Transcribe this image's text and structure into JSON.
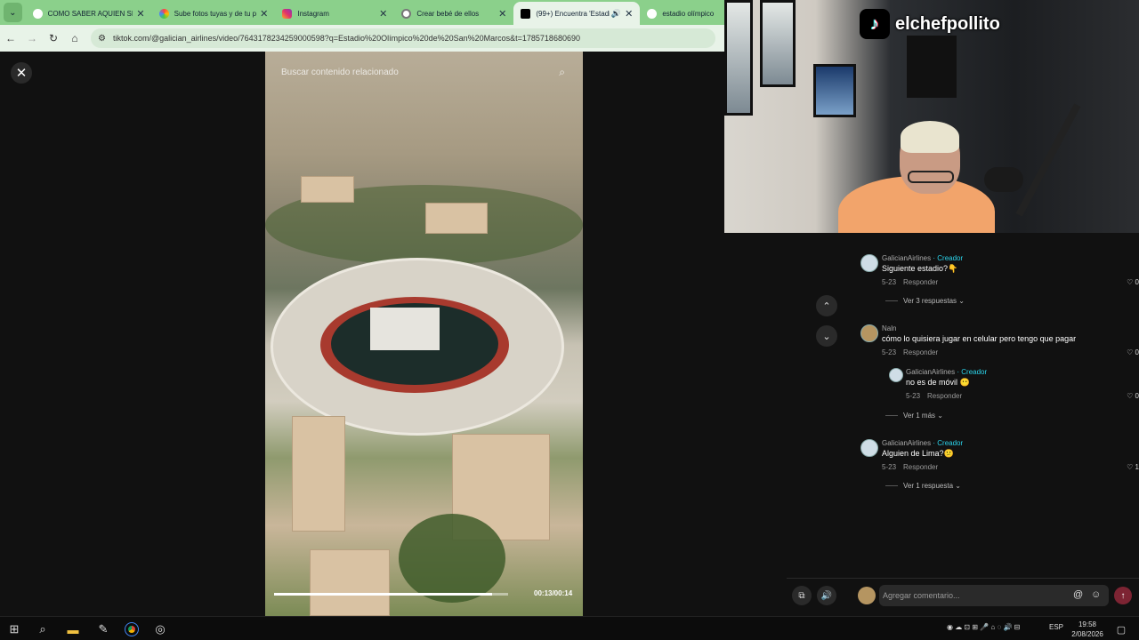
{
  "browser": {
    "tabs": [
      {
        "title": "COMO SABER AQUIEN SE",
        "favicon_color": "#ffffff",
        "active": false
      },
      {
        "title": "Sube fotos tuyas y de tu p",
        "favicon_color": "#ffb300",
        "active": false
      },
      {
        "title": "Instagram",
        "favicon_color": "#e1306c",
        "active": false
      },
      {
        "title": "Crear bebé de ellos",
        "favicon_color": "#ffffff",
        "active": false
      },
      {
        "title": "(99+) Encuentra 'Estadi",
        "favicon_color": "#000000",
        "active": true
      },
      {
        "title": "estadio olímpico",
        "favicon_color": "#ffffff",
        "active": false
      }
    ],
    "url": "tiktok.com/@galician_airlines/video/7643178234259000598?q=Estadio%20Olímpico%20de%20San%20Marcos&t=1785718680690"
  },
  "video": {
    "search_placeholder": "Buscar contenido relacionado",
    "timecode": "00:13/00:14",
    "progress": 0.93
  },
  "stream_overlay": {
    "channel_name": "elchefpollito"
  },
  "comments": [
    {
      "user": "GalicianAirlines",
      "creator_label": "· Creador",
      "is_creator": true,
      "text": "Siguiente estadio?👇",
      "date": "5-23",
      "reply_label": "Responder",
      "likes": "0",
      "more": "Ver 3 respuestas"
    },
    {
      "user": "Naln",
      "creator_label": "",
      "is_creator": false,
      "text": "cómo lo quisiera jugar en celular pero tengo que pagar",
      "date": "5-23",
      "reply_label": "Responder",
      "likes": "0",
      "more": ""
    },
    {
      "user": "GalicianAirlines",
      "creator_label": "· Creador",
      "is_creator": true,
      "text": "no es de móvil 😶",
      "date": "5-23",
      "reply_label": "Responder",
      "likes": "0",
      "more": "Ver 1 más",
      "is_reply": true
    },
    {
      "user": "GalicianAirlines",
      "creator_label": "· Creador",
      "is_creator": true,
      "text": "Alguien de Lima?😕",
      "date": "5-23",
      "reply_label": "Responder",
      "likes": "1",
      "more": "Ver 1 respuesta"
    }
  ],
  "comment_input": {
    "placeholder": "Agregar comentario..."
  },
  "taskbar": {
    "language": "ESP",
    "time": "19:58",
    "date": "2/08/2026"
  }
}
